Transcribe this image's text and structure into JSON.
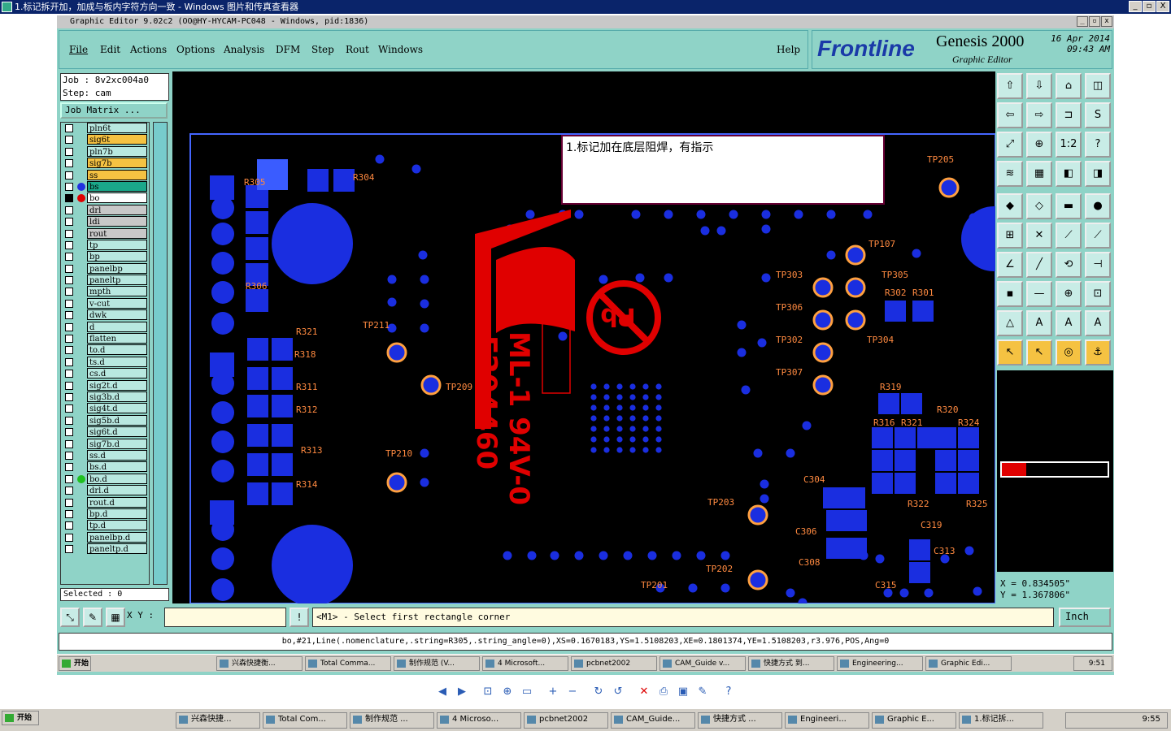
{
  "outer_window": {
    "title": "1.标记拆开加，加成与板内字符方向一致 - Windows 图片和传真查看器",
    "minimize": "_",
    "restore": "▫",
    "close": "X"
  },
  "app_window": {
    "title": "Graphic Editor 9.02c2 (OO@HY-HYCAM-PC048 - Windows, pid:1836)"
  },
  "menu": {
    "file": "File",
    "edit": "Edit",
    "actions": "Actions",
    "options": "Options",
    "analysis": "Analysis",
    "dfm": "DFM",
    "step": "Step",
    "rout": "Rout",
    "windows": "Windows",
    "help": "Help"
  },
  "logo": {
    "brand": "Frontline",
    "product": "Genesis 2000",
    "subtitle": "Graphic Editor",
    "date": "16 Apr 2014",
    "time": "09:43 AM"
  },
  "job": {
    "job_line": "Job : 8v2xc004a0",
    "step_line": "Step: cam",
    "matrix_button": "Job Matrix ..."
  },
  "layers": [
    {
      "name": "pln6t",
      "color": "#b8e8e0",
      "on": false
    },
    {
      "name": "sig6t",
      "color": "#f5c242",
      "on": false
    },
    {
      "name": "pln7b",
      "color": "#b8e8e0",
      "on": false
    },
    {
      "name": "sig7b",
      "color": "#f5c242",
      "on": false
    },
    {
      "name": "ss",
      "color": "#f5c242",
      "on": false
    },
    {
      "name": "bs",
      "color": "#1aa88a",
      "on": false,
      "dot": "#2030e0"
    },
    {
      "name": "bo",
      "color": "#ffffff",
      "on": true,
      "dot": "#e00000"
    },
    {
      "name": "drl",
      "color": "#c8c8c8",
      "on": false
    },
    {
      "name": "ldi",
      "color": "#c8c8c8",
      "on": false
    },
    {
      "name": "rout",
      "color": "#c8c8c8",
      "on": false
    },
    {
      "name": "tp",
      "color": "#b8e8e0",
      "on": false
    },
    {
      "name": "bp",
      "color": "#b8e8e0",
      "on": false
    },
    {
      "name": "panelbp",
      "color": "#b8e8e0",
      "on": false
    },
    {
      "name": "paneltp",
      "color": "#b8e8e0",
      "on": false
    },
    {
      "name": "mpth",
      "color": "#b8e8e0",
      "on": false
    },
    {
      "name": "v-cut",
      "color": "#b8e8e0",
      "on": false
    },
    {
      "name": "dwk",
      "color": "#b8e8e0",
      "on": false
    },
    {
      "name": "d",
      "color": "#b8e8e0",
      "on": false
    },
    {
      "name": "flatten",
      "color": "#b8e8e0",
      "on": false
    },
    {
      "name": "to.d",
      "color": "#b8e8e0",
      "on": false
    },
    {
      "name": "ts.d",
      "color": "#b8e8e0",
      "on": false
    },
    {
      "name": "cs.d",
      "color": "#b8e8e0",
      "on": false
    },
    {
      "name": "sig2t.d",
      "color": "#b8e8e0",
      "on": false
    },
    {
      "name": "sig3b.d",
      "color": "#b8e8e0",
      "on": false
    },
    {
      "name": "sig4t.d",
      "color": "#b8e8e0",
      "on": false
    },
    {
      "name": "sig5b.d",
      "color": "#b8e8e0",
      "on": false
    },
    {
      "name": "sig6t.d",
      "color": "#b8e8e0",
      "on": false
    },
    {
      "name": "sig7b.d",
      "color": "#b8e8e0",
      "on": false
    },
    {
      "name": "ss.d",
      "color": "#b8e8e0",
      "on": false
    },
    {
      "name": "bs.d",
      "color": "#b8e8e0",
      "on": false
    },
    {
      "name": "bo.d",
      "color": "#b8e8e0",
      "on": false,
      "dot": "#20c020"
    },
    {
      "name": "drl.d",
      "color": "#b8e8e0",
      "on": false
    },
    {
      "name": "rout.d",
      "color": "#b8e8e0",
      "on": false
    },
    {
      "name": "bp.d",
      "color": "#b8e8e0",
      "on": false
    },
    {
      "name": "tp.d",
      "color": "#b8e8e0",
      "on": false
    },
    {
      "name": "panelbp.d",
      "color": "#b8e8e0",
      "on": false
    },
    {
      "name": "paneltp.d",
      "color": "#b8e8e0",
      "on": false
    }
  ],
  "selected": "Selected : 0",
  "annotation": "1.标记加在底层阻焊，有指示",
  "canvas_labels": {
    "r305": "R305",
    "r304": "R304",
    "r306": "R306",
    "r321": "R321",
    "r318": "R318",
    "r311": "R311",
    "r312": "R312",
    "r313": "R313",
    "r314": "R314",
    "tp211": "TP211",
    "tp209": "TP209",
    "tp210": "TP210",
    "tp205": "TP205",
    "tp107": "TP107",
    "tp303": "TP303",
    "tp305": "TP305",
    "tp306": "TP306",
    "tp302": "TP302",
    "tp304": "TP304",
    "tp307": "TP307",
    "tp203": "TP203",
    "tp202": "TP202",
    "tp201": "TP201",
    "r301": "R301",
    "r302": "R302",
    "r319": "R319",
    "r320": "R320",
    "r321b": "R321",
    "r316": "R316",
    "r324": "R324",
    "r322": "R322",
    "r325": "R325",
    "c304": "C304",
    "c306": "C306",
    "c308": "C308",
    "c313": "C313",
    "c319": "C319",
    "c315": "C315",
    "logo_text": "E204460",
    "ml_text": "ML-1 94V-0"
  },
  "coords": {
    "x": "X = 0.834505\"",
    "y": "Y = 1.367806\""
  },
  "bottom": {
    "xy_label": "X Y :",
    "xy_value": "",
    "message": "<M1> - Select first rectangle corner",
    "units": "Inch"
  },
  "feature_line": "bo,#21,Line(.nomenclature,.string=R305,.string_angle=0),XS=0.1670183,YS=1.5108203,XE=0.1801374,YE=1.5108203,r3.976,POS,Ang=0",
  "inner_taskbar": {
    "start": "开始",
    "items": [
      "兴森快捷衡...",
      "Total Comma...",
      "制作规范 (V...",
      "4 Microsoft...",
      "pcbnet2002",
      "CAM_Guide v...",
      "快捷方式 到...",
      "Engineering...",
      "Graphic Edi..."
    ],
    "clock": "9:51"
  },
  "outer_taskbar": {
    "start": "开始",
    "items": [
      "兴森快捷...",
      "Total Com...",
      "制作规范 ...",
      "4 Microso...",
      "pcbnet2002",
      "CAM_Guide...",
      "快捷方式 ...",
      "Engineeri...",
      "Graphic E...",
      "1.标记拆..."
    ],
    "clock": "9:55"
  }
}
